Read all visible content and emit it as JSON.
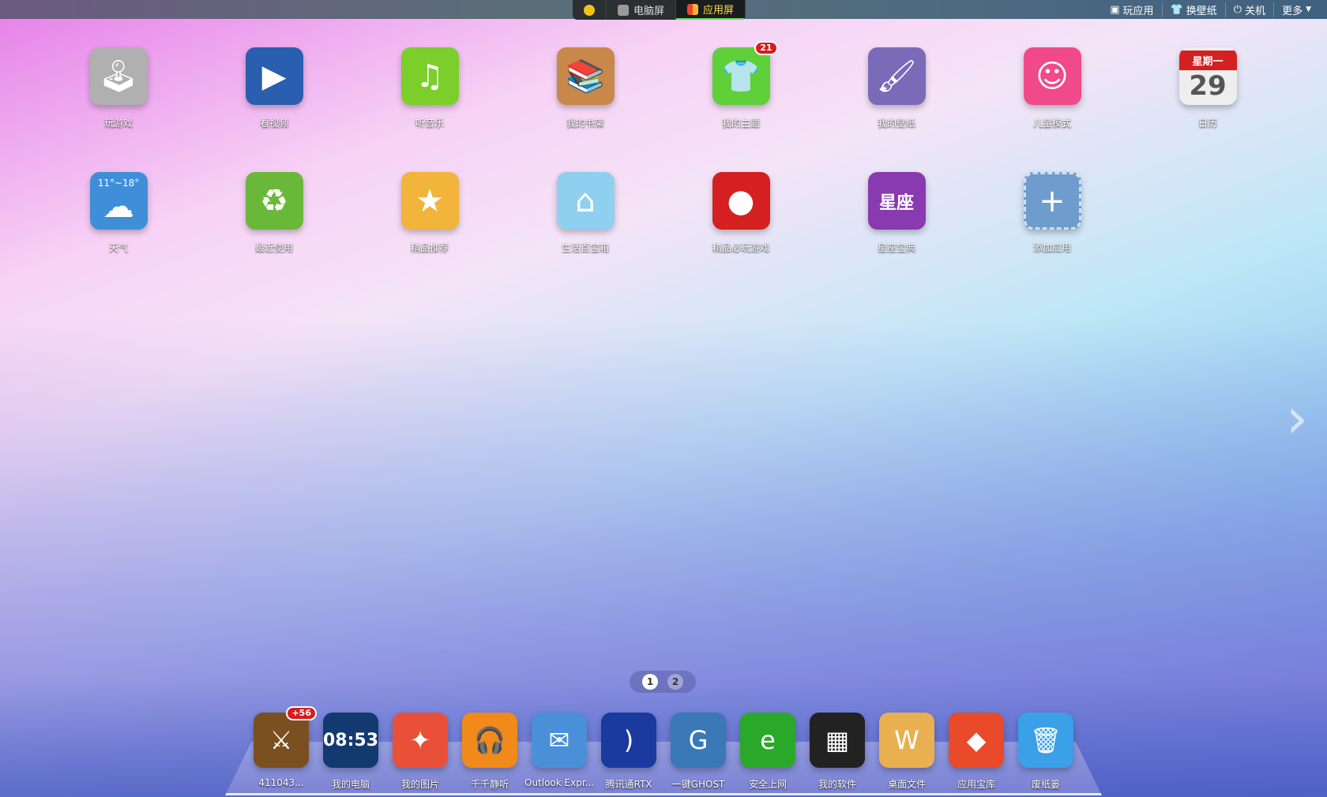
{
  "topbar": {
    "tabs": [
      {
        "label": "",
        "icon": "home-icon"
      },
      {
        "label": "电脑屏",
        "icon": "windows-icon"
      },
      {
        "label": "应用屏",
        "icon": "cube-icon",
        "active": true
      }
    ],
    "menu": [
      {
        "label": "玩应用",
        "icon": "box-icon"
      },
      {
        "label": "换壁纸",
        "icon": "shirt-icon"
      },
      {
        "label": "关机",
        "icon": "power-icon"
      },
      {
        "label": "更多",
        "icon": "chevron-down-icon"
      }
    ]
  },
  "apps": [
    {
      "label": "玩游戏",
      "icon": "joystick-icon",
      "glyph": "🕹",
      "color": "#b0b0b0"
    },
    {
      "label": "看视频",
      "icon": "clapperboard-icon",
      "glyph": "▶",
      "color": "#2a5fb0"
    },
    {
      "label": "听音乐",
      "icon": "music-note-icon",
      "glyph": "♫",
      "color": "#7ccf2a"
    },
    {
      "label": "我的书架",
      "icon": "bookshelf-icon",
      "glyph": "📚",
      "color": "#c8884a"
    },
    {
      "label": "我的主题",
      "icon": "tshirt-icon",
      "glyph": "👕",
      "color": "#5fcf3a",
      "badge": "21"
    },
    {
      "label": "我的壁纸",
      "icon": "wallpaper-icon",
      "glyph": "🖌",
      "color": "#7a6ab8"
    },
    {
      "label": "儿童模式",
      "icon": "kid-icon",
      "glyph": "☺",
      "color": "#f04a8a"
    },
    {
      "label": "日历",
      "icon": "calendar-icon",
      "glyph": "29",
      "header": "星期一",
      "color": "#eeeeee"
    },
    {
      "label": "天气",
      "icon": "weather-icon",
      "glyph": "☁",
      "temp": "11°~18°",
      "color": "#3f8fd8"
    },
    {
      "label": "最近使用",
      "icon": "recent-folder-icon",
      "glyph": "♻",
      "color": "#6ab83a"
    },
    {
      "label": "精品推荐",
      "icon": "star-tag-icon",
      "glyph": "★",
      "color": "#f2b43a"
    },
    {
      "label": "生活百宝箱",
      "icon": "house-icon",
      "glyph": "⌂",
      "color": "#8fd0f0"
    },
    {
      "label": "精品必玩游戏",
      "icon": "angry-bird-icon",
      "glyph": "●",
      "color": "#d42020"
    },
    {
      "label": "星座宝典",
      "icon": "horoscope-icon",
      "glyph": "星座",
      "color": "#8a3ab0"
    },
    {
      "label": "添加应用",
      "icon": "add-icon",
      "glyph": "+",
      "color": "#6e9ccc"
    }
  ],
  "pager": {
    "pages": [
      "1",
      "2"
    ],
    "current": "1"
  },
  "dock": [
    {
      "label": "411043...",
      "icon": "game-avatar-icon",
      "glyph": "⚔",
      "color": "#7a5020",
      "badge": "+56"
    },
    {
      "label": "我的电脑",
      "icon": "computer-icon",
      "glyph": "08:53",
      "color": "#123a70"
    },
    {
      "label": "我的图片",
      "icon": "photos-icon",
      "glyph": "✦",
      "color": "#e8503a"
    },
    {
      "label": "千千静听",
      "icon": "ttplayer-icon",
      "glyph": "🎧",
      "color": "#f08a1a"
    },
    {
      "label": "Outlook Expr...",
      "icon": "outlook-icon",
      "glyph": "✉",
      "color": "#4a90d8"
    },
    {
      "label": "腾讯通RTX",
      "icon": "rtx-icon",
      "glyph": ")",
      "color": "#1a3aa0"
    },
    {
      "label": "一键GHOST",
      "icon": "ghost-icon",
      "glyph": "G",
      "color": "#3a78b8"
    },
    {
      "label": "安全上网",
      "icon": "browser-icon",
      "glyph": "e",
      "color": "#2aa82a"
    },
    {
      "label": "我的软件",
      "icon": "software-folder-icon",
      "glyph": "▦",
      "color": "#222222"
    },
    {
      "label": "桌面文件",
      "icon": "desktop-files-icon",
      "glyph": "W",
      "color": "#e8b050"
    },
    {
      "label": "应用宝库",
      "icon": "app-store-icon",
      "glyph": "◆",
      "color": "#e84a2a"
    },
    {
      "label": "废纸篓",
      "icon": "trash-icon",
      "glyph": "🗑",
      "color": "#3aa0e8"
    }
  ]
}
